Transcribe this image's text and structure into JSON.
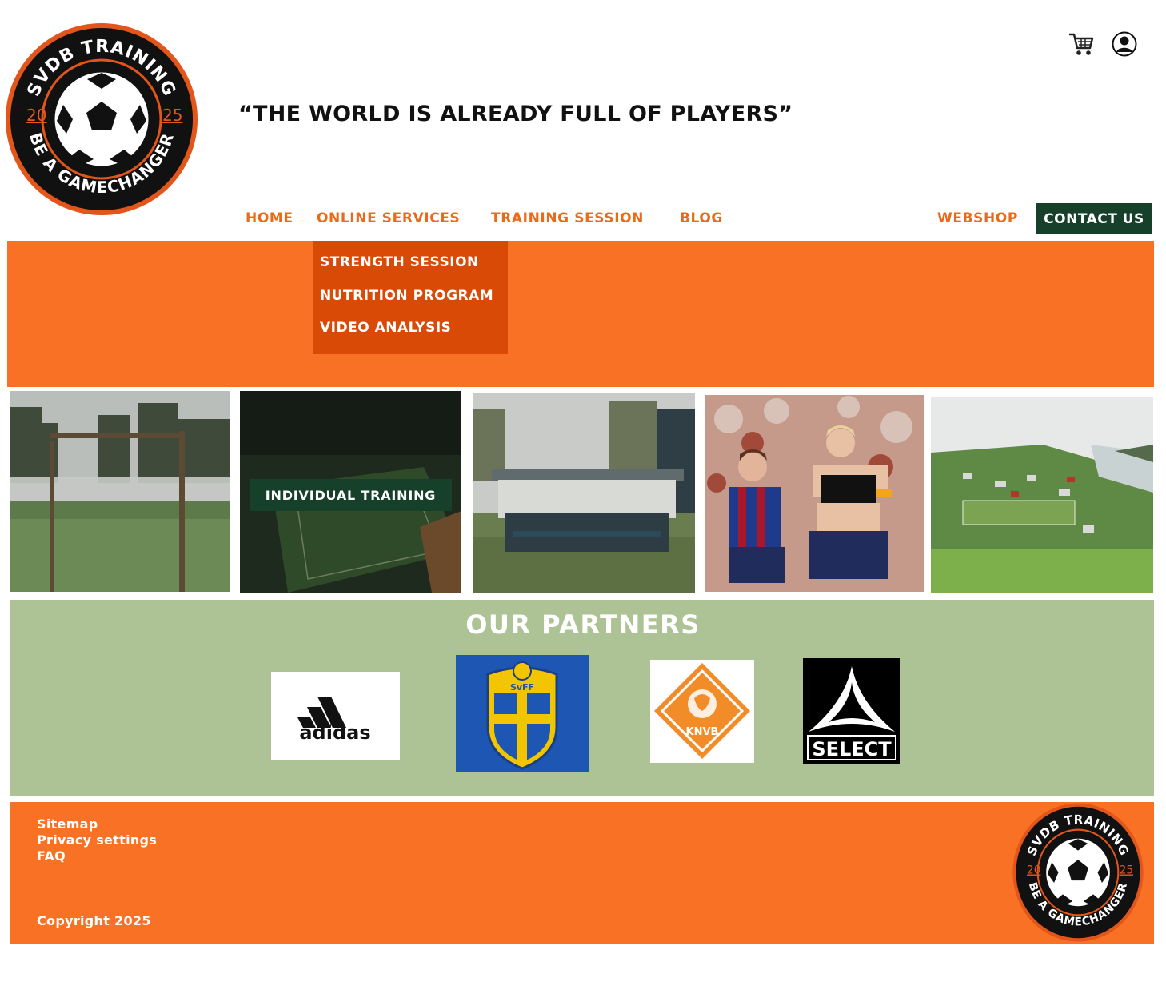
{
  "brand": {
    "logo_ring_top": "SVDB TRAINING",
    "logo_ring_bottom": "BE A GAMECHANGER",
    "logo_year_left": "20",
    "logo_year_right": "25",
    "colors": {
      "orange": "#f87124",
      "dark_orange": "#d84a06",
      "dark_green": "#17402a",
      "sage": "#adc395"
    }
  },
  "header": {
    "tagline": "“THE WORLD IS ALREADY FULL OF PLAYERS”",
    "icons": [
      "cart-icon",
      "user-account-icon"
    ]
  },
  "nav": {
    "home": "HOME",
    "online_services": "ONLINE SERVICES",
    "training_session": "TRAINING SESSION",
    "blog": "BLOG",
    "webshop": "WEBSHOP",
    "contact": "CONTACT US"
  },
  "dropdown": {
    "items": [
      "STRENGTH SESSION",
      "NUTRITION PROGRAM",
      "VIDEO ANALYSIS"
    ]
  },
  "gallery": {
    "overlay_button": "INDIVIDUAL TRAINING",
    "photos": [
      "misty-goalpost-photo",
      "aerial-pitch-photo",
      "dugout-photo",
      "players-celebrating-photo",
      "village-pitch-photo"
    ]
  },
  "partners": {
    "title": "OUR PARTNERS",
    "logos": [
      {
        "name": "adidas",
        "text": "adidas"
      },
      {
        "name": "svff",
        "text": "SvFF"
      },
      {
        "name": "knvb",
        "text": "KNVB"
      },
      {
        "name": "select",
        "text": "SELECT"
      }
    ]
  },
  "footer": {
    "links": [
      "Sitemap",
      "Privacy settings",
      "FAQ"
    ],
    "copyright": "Copyright 2025"
  }
}
